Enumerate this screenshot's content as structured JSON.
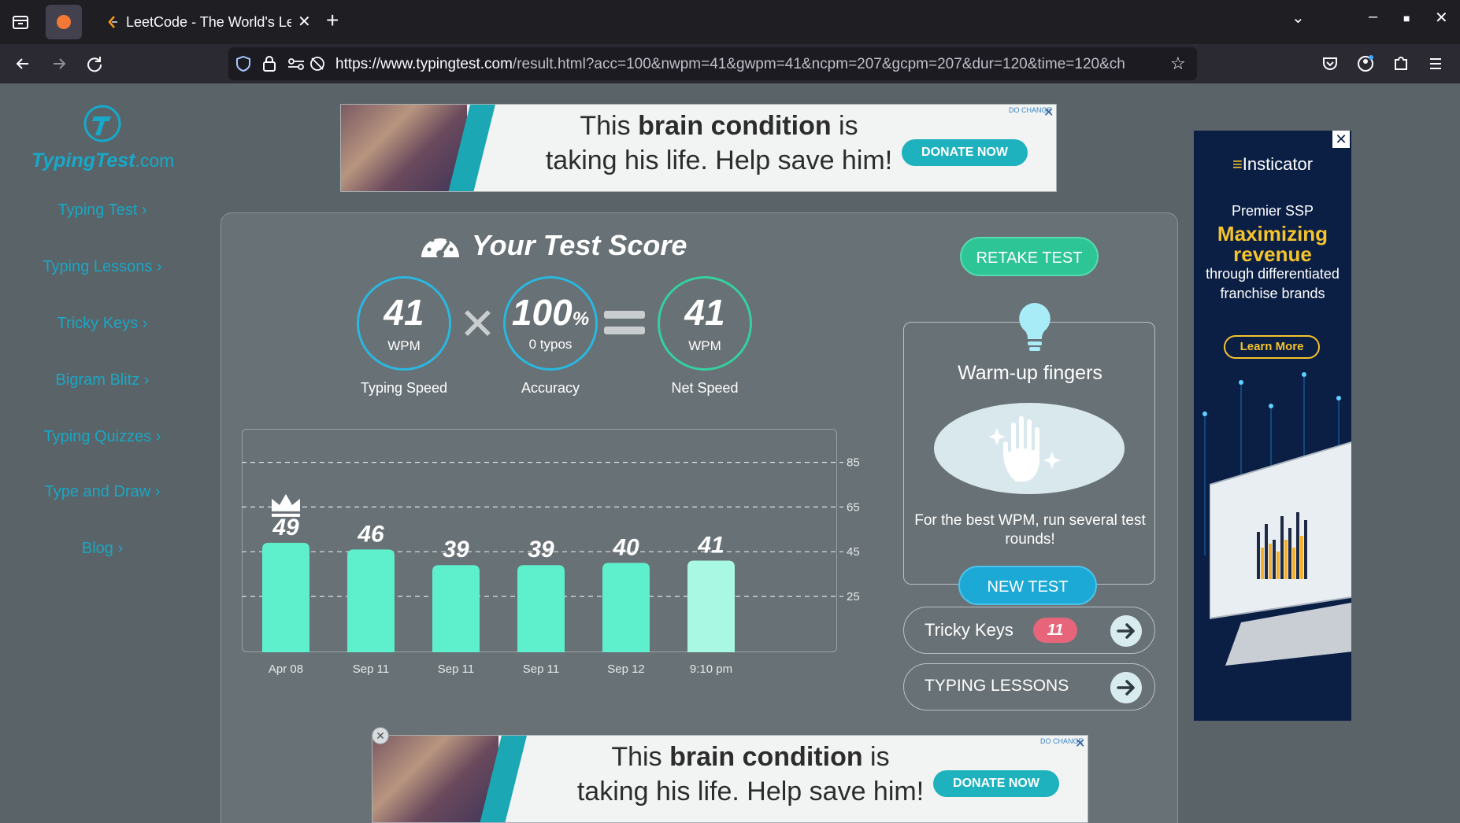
{
  "browser": {
    "tabs": [
      {
        "title": ""
      },
      {
        "title": "LeetCode - The World's Leading Online Programming Learning Platform"
      }
    ],
    "url_host": "https://www.typingtest.com",
    "url_rest": "/result.html?acc=100&nwpm=41&gwpm=41&ncpm=207&gcpm=207&dur=120&time=120&ch"
  },
  "site": {
    "logo_main": "TypingTest",
    "logo_suffix": ".com",
    "nav": [
      {
        "label": "Typing Test"
      },
      {
        "label": "Typing Lessons"
      },
      {
        "label": "Tricky Keys"
      },
      {
        "label": "Bigram Blitz"
      },
      {
        "label": "Typing Quizzes"
      },
      {
        "label": "Type and Draw"
      },
      {
        "label": "Blog"
      }
    ]
  },
  "ads": {
    "top": {
      "line1_pre": "This ",
      "line1_bold": "brain condition",
      "line1_post": " is",
      "line2": "taking his life. Help save him!",
      "button": "DONATE NOW",
      "choice": "DO CHANGE"
    },
    "right": {
      "brand": "Insticator",
      "line1": "Premier SSP",
      "line2": "Maximizing revenue",
      "line3": "through differentiated franchise brands",
      "button": "Learn More"
    }
  },
  "score": {
    "title": "Your Test Score",
    "typing_speed": {
      "value": "41",
      "unit": "WPM",
      "label": "Typing Speed"
    },
    "accuracy": {
      "value": "100",
      "unit": "%",
      "sub": "0 typos",
      "label": "Accuracy"
    },
    "net_speed": {
      "value": "41",
      "unit": "WPM",
      "label": "Net Speed"
    }
  },
  "chart_data": {
    "type": "bar",
    "categories": [
      "Apr 08",
      "Sep 11",
      "Sep 11",
      "Sep 11",
      "Sep 12",
      "9:10 pm"
    ],
    "values": [
      49,
      46,
      39,
      39,
      40,
      41
    ],
    "ylim": [
      0,
      100
    ],
    "yticks": [
      25,
      45,
      65,
      85
    ],
    "best_index": 0,
    "current_index": 5,
    "grid": "dashed horizontal",
    "colors": {
      "bar": "#5ef0cc",
      "current": "#a9f8e4"
    }
  },
  "side": {
    "retake": "RETAKE TEST",
    "warm_title": "Warm-up fingers",
    "warm_text": "For the best WPM, run several test rounds!",
    "new_test": "NEW TEST",
    "tricky_keys": "Tricky Keys",
    "tricky_count": "11",
    "lessons": "TYPING LESSONS"
  }
}
